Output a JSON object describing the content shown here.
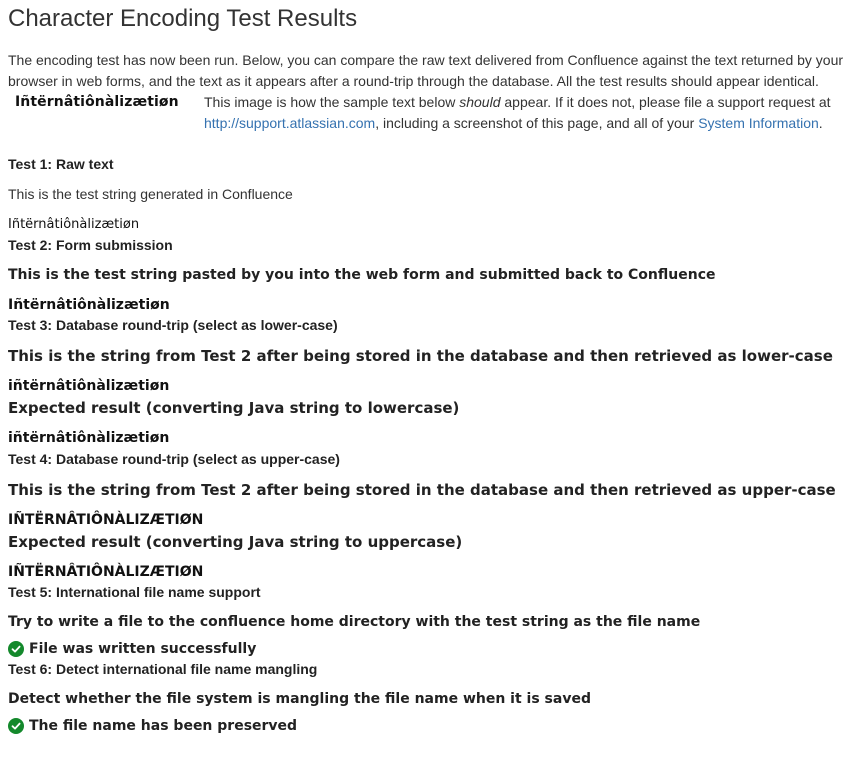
{
  "page": {
    "title": "Character Encoding Test Results",
    "intro": "The encoding test has now been run. Below, you can compare the raw text delivered from Confluence against the text returned by your browser in web forms, and the text as it appears after a round-trip through the database. All the test results should appear identical."
  },
  "sample": {
    "image_text": "Iñtërnâtiônàlizætiøn",
    "text_before_em": "This image is how the sample text below ",
    "text_em": "should",
    "text_after_em": " appear. If it does not, please file a support request at ",
    "support_link": "http://support.atlassian.com",
    "text_middle": ", including a screenshot of this page, and all of your ",
    "system_info_link": "System Information",
    "text_end": "."
  },
  "tests": {
    "test1": {
      "title": "Test 1: Raw text",
      "description": "This is the test string generated in Confluence",
      "value": "Iñtërnâtiônàlizætiøn"
    },
    "test2": {
      "title": "Test 2: Form submission",
      "description": "This is the test string pasted by you into the web form and submitted back to Confluence",
      "value": "Iñtërnâtiônàlizætiøn"
    },
    "test3": {
      "title": "Test 3: Database round-trip (select as lower-case)",
      "description": "This is the string from Test 2 after being stored in the database and then retrieved as lower-case",
      "value": "iñtërnâtiônàlizætiøn",
      "expected_label": "Expected result (converting Java string to lowercase)",
      "expected_value": "iñtërnâtiônàlizætiøn"
    },
    "test4": {
      "title": "Test 4: Database round-trip (select as upper-case)",
      "description": "This is the string from Test 2 after being stored in the database and then retrieved as upper-case",
      "value": "IÑTËRNÂTIÔNÀLIZÆTIØN",
      "expected_label": "Expected result (converting Java string to uppercase)",
      "expected_value": "IÑTËRNÂTIÔNÀLIZÆTIØN"
    },
    "test5": {
      "title": "Test 5: International file name support",
      "description": "Try to write a file to the confluence home directory with the test string as the file name",
      "status": "File was written successfully"
    },
    "test6": {
      "title": "Test 6: Detect international file name mangling",
      "description": "Detect whether the file system is mangling the file name when it is saved",
      "status": "The file name has been preserved"
    }
  },
  "colors": {
    "link": "#3572b0",
    "success": "#14892c",
    "text": "#333333"
  },
  "icons": {
    "success": "check-circle-icon"
  }
}
